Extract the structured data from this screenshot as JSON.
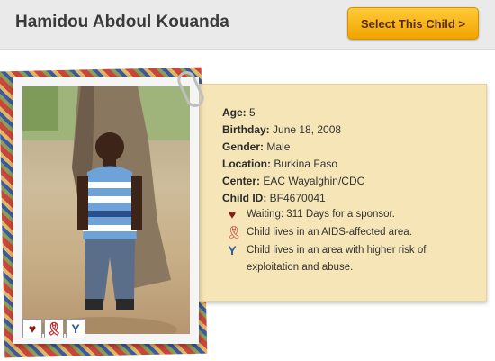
{
  "child": {
    "name": "Hamidou Abdoul Kouanda"
  },
  "actions": {
    "select_label": "Select This Child >"
  },
  "details": {
    "age_label": "Age:",
    "age": "5",
    "birthday_label": "Birthday:",
    "birthday": "June 18, 2008",
    "gender_label": "Gender:",
    "gender": "Male",
    "location_label": "Location:",
    "location": "Burkina Faso",
    "center_label": "Center:",
    "center": "EAC Wayalghin/CDC",
    "childid_label": "Child ID:",
    "child_id": "BF4670041"
  },
  "flags": [
    {
      "icon": "heart-icon",
      "text": "Waiting: 311 Days for a sponsor."
    },
    {
      "icon": "aids-ribbon-icon",
      "text": "Child lives in an AIDS-affected area."
    },
    {
      "icon": "y-icon",
      "text": "Child lives in an area with higher risk of exploitation and abuse."
    }
  ],
  "colors": {
    "heart": "#8b1a1a",
    "ribbon": "#c0282c",
    "y": "#2f5b9c",
    "button": "#f6b818"
  }
}
